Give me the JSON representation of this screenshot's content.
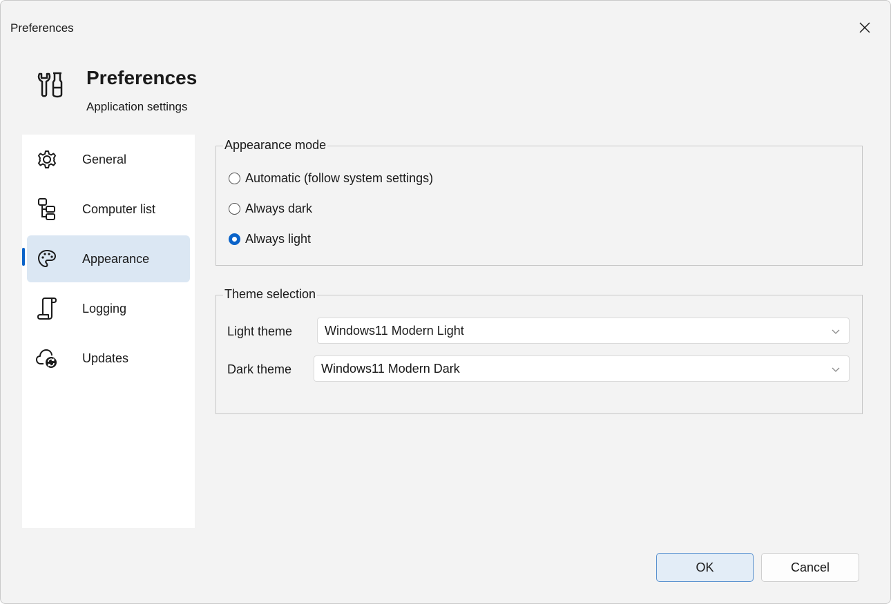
{
  "window": {
    "title": "Preferences",
    "close_icon": "close-icon"
  },
  "header": {
    "icon": "tools-icon",
    "title": "Preferences",
    "subtitle": "Application settings"
  },
  "sidebar": {
    "items": [
      {
        "label": "General",
        "icon": "gear-icon",
        "selected": false
      },
      {
        "label": "Computer list",
        "icon": "tree-icon",
        "selected": false
      },
      {
        "label": "Appearance",
        "icon": "palette-icon",
        "selected": true
      },
      {
        "label": "Logging",
        "icon": "scroll-icon",
        "selected": false
      },
      {
        "label": "Updates",
        "icon": "cloud-sync-icon",
        "selected": false
      }
    ]
  },
  "appearance_mode": {
    "legend": "Appearance mode",
    "options": [
      {
        "label": "Automatic (follow system settings)",
        "checked": false
      },
      {
        "label": "Always dark",
        "checked": false
      },
      {
        "label": "Always light",
        "checked": true
      }
    ]
  },
  "theme_selection": {
    "legend": "Theme selection",
    "light_label": "Light theme",
    "light_value": "Windows11 Modern Light",
    "dark_label": "Dark theme",
    "dark_value": "Windows11 Modern Dark"
  },
  "buttons": {
    "ok": "OK",
    "cancel": "Cancel"
  },
  "colors": {
    "accent": "#0a63c9",
    "selected_bg": "#dbe7f3",
    "window_bg": "#f3f3f3"
  }
}
